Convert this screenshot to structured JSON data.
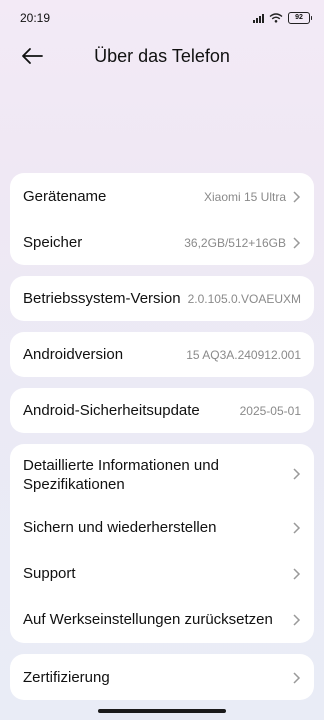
{
  "status": {
    "time": "20:19",
    "battery": "92"
  },
  "header": {
    "title": "Über das Telefon"
  },
  "rows": {
    "device_name": {
      "label": "Gerätename",
      "value": "Xiaomi 15 Ultra"
    },
    "storage": {
      "label": "Speicher",
      "value": "36,2GB/512+16GB"
    },
    "os_version": {
      "label": "Betriebssystem-Version",
      "value": "2.0.105.0.VOAEUXM"
    },
    "android_version": {
      "label": "Androidversion",
      "value": "15 AQ3A.240912.001"
    },
    "security_update": {
      "label": "Android-Sicherheitsupdate",
      "value": "2025-05-01"
    },
    "detailed_info": {
      "label_line1": "Detaillierte Informationen und",
      "label_line2": "Spezifikationen"
    },
    "backup": {
      "label": "Sichern und wiederherstellen"
    },
    "support": {
      "label": "Support"
    },
    "factory_reset": {
      "label": "Auf Werkseinstellungen zurücksetzen"
    },
    "certification": {
      "label": "Zertifizierung"
    }
  }
}
